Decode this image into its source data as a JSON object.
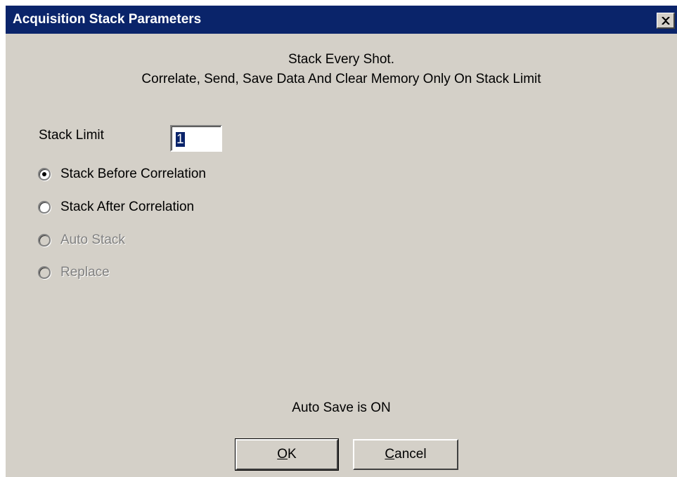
{
  "window": {
    "title": "Acquisition Stack Parameters"
  },
  "header": {
    "line1": "Stack Every Shot.",
    "line2": "Correlate, Send, Save Data And Clear Memory Only On Stack Limit"
  },
  "stack_limit": {
    "label": "Stack Limit",
    "value": "1"
  },
  "options": [
    {
      "label": "Stack Before Correlation",
      "checked": true,
      "enabled": true
    },
    {
      "label": "Stack After Correlation",
      "checked": false,
      "enabled": true
    },
    {
      "label": "Auto Stack",
      "checked": false,
      "enabled": false
    },
    {
      "label": "Replace",
      "checked": false,
      "enabled": false
    }
  ],
  "status": {
    "auto_save": "Auto Save is ON"
  },
  "buttons": {
    "ok_mnemonic": "O",
    "ok_rest": "K",
    "cancel_mnemonic": "C",
    "cancel_rest": "ancel"
  },
  "icons": {
    "close": "close-icon"
  },
  "colors": {
    "titlebar": "#0a246a",
    "face": "#d4d0c8",
    "disabled_text": "#808080"
  }
}
